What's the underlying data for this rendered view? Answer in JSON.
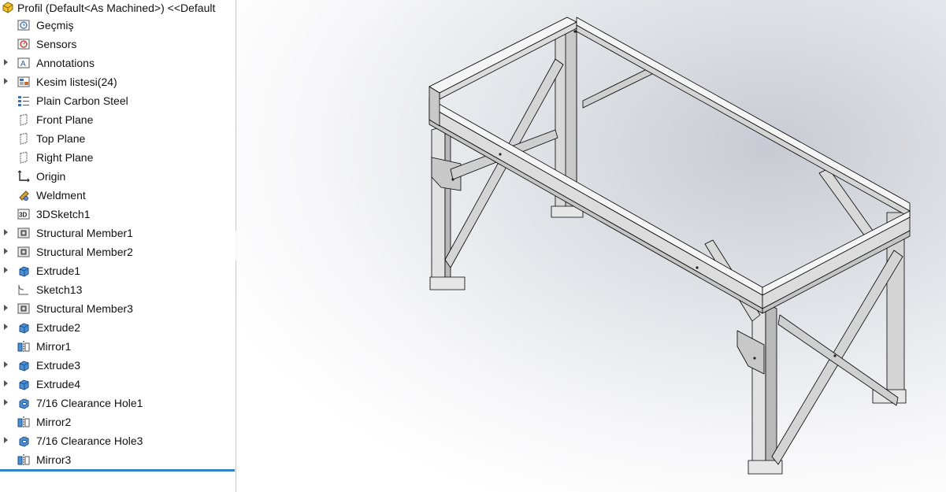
{
  "tree": {
    "root_label": "Profil  (Default<As Machined>) <<Default",
    "items": [
      {
        "label": "Geçmiş",
        "icon": "history-icon",
        "expandable": false
      },
      {
        "label": "Sensors",
        "icon": "sensors-icon",
        "expandable": false
      },
      {
        "label": "Annotations",
        "icon": "annotations-icon",
        "expandable": true
      },
      {
        "label": "Kesim listesi(24)",
        "icon": "cut-list-icon",
        "expandable": true
      },
      {
        "label": "Plain Carbon Steel",
        "icon": "material-icon",
        "expandable": false
      },
      {
        "label": "Front Plane",
        "icon": "plane-icon",
        "expandable": false
      },
      {
        "label": "Top Plane",
        "icon": "plane-icon",
        "expandable": false
      },
      {
        "label": "Right Plane",
        "icon": "plane-icon",
        "expandable": false
      },
      {
        "label": "Origin",
        "icon": "origin-icon",
        "expandable": false
      },
      {
        "label": "Weldment",
        "icon": "weldment-icon",
        "expandable": false
      },
      {
        "label": "3DSketch1",
        "icon": "3d-sketch-icon",
        "expandable": false
      },
      {
        "label": "Structural Member1",
        "icon": "structural-member-icon",
        "expandable": true
      },
      {
        "label": "Structural Member2",
        "icon": "structural-member-icon",
        "expandable": true
      },
      {
        "label": "Extrude1",
        "icon": "extrude-icon",
        "expandable": true
      },
      {
        "label": "Sketch13",
        "icon": "sketch-icon",
        "expandable": false
      },
      {
        "label": "Structural Member3",
        "icon": "structural-member-icon",
        "expandable": true
      },
      {
        "label": "Extrude2",
        "icon": "extrude-icon",
        "expandable": true
      },
      {
        "label": "Mirror1",
        "icon": "mirror-icon",
        "expandable": false
      },
      {
        "label": "Extrude3",
        "icon": "extrude-icon",
        "expandable": true
      },
      {
        "label": "Extrude4",
        "icon": "extrude-icon",
        "expandable": true
      },
      {
        "label": "7/16 Clearance Hole1",
        "icon": "hole-wizard-icon",
        "expandable": true
      },
      {
        "label": "Mirror2",
        "icon": "mirror-icon",
        "expandable": false
      },
      {
        "label": "7/16 Clearance Hole3",
        "icon": "hole-wizard-icon",
        "expandable": true
      },
      {
        "label": "Mirror3",
        "icon": "mirror-icon",
        "expandable": false
      }
    ]
  },
  "colors": {
    "rollback_bar": "#2f86c4",
    "steel_face_light": "#f2f2f2",
    "steel_face_mid": "#d9d9d9",
    "steel_face_dark": "#b7b7b7",
    "edge": "#000000"
  }
}
